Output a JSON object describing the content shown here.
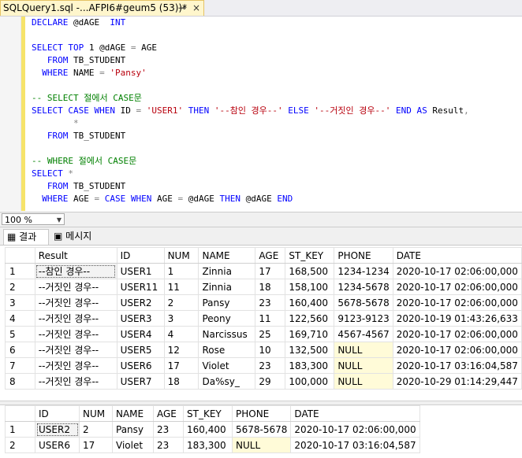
{
  "tab": {
    "title": "SQLQuery1.sql -...AFPI6#geum5 (53))*",
    "pin": "⊸",
    "close": "×"
  },
  "code_lines": [
    [
      [
        "kw",
        "DECLARE "
      ],
      [
        "t",
        "@dAGE  "
      ],
      [
        "kw",
        "INT"
      ]
    ],
    [],
    [
      [
        "kw",
        "SELECT TOP "
      ],
      [
        "t",
        "1 @dAGE "
      ],
      [
        "op",
        "= "
      ],
      [
        "t",
        "AGE"
      ]
    ],
    [
      [
        "t",
        "   "
      ],
      [
        "kw",
        "FROM "
      ],
      [
        "t",
        "TB_STUDENT"
      ]
    ],
    [
      [
        "t",
        "  "
      ],
      [
        "kw",
        "WHERE "
      ],
      [
        "t",
        "NAME "
      ],
      [
        "op",
        "= "
      ],
      [
        "str",
        "'Pansy'"
      ]
    ],
    [],
    [
      [
        "cm",
        "-- SELECT 절에서 CASE문"
      ]
    ],
    [
      [
        "kw",
        "SELECT CASE WHEN "
      ],
      [
        "t",
        "ID "
      ],
      [
        "op",
        "= "
      ],
      [
        "str",
        "'USER1' "
      ],
      [
        "kw",
        "THEN "
      ],
      [
        "str",
        "'--참인 경우--' "
      ],
      [
        "kw",
        "ELSE "
      ],
      [
        "str",
        "'--거짓인 경우--' "
      ],
      [
        "kw",
        "END AS "
      ],
      [
        "t",
        "Result"
      ],
      [
        "op",
        ","
      ]
    ],
    [
      [
        "t",
        "        "
      ],
      [
        "op",
        "*"
      ]
    ],
    [
      [
        "t",
        "   "
      ],
      [
        "kw",
        "FROM "
      ],
      [
        "t",
        "TB_STUDENT"
      ]
    ],
    [],
    [
      [
        "cm",
        "-- WHERE 절에서 CASE문"
      ]
    ],
    [
      [
        "kw",
        "SELECT "
      ],
      [
        "op",
        "*"
      ]
    ],
    [
      [
        "t",
        "   "
      ],
      [
        "kw",
        "FROM "
      ],
      [
        "t",
        "TB_STUDENT"
      ]
    ],
    [
      [
        "t",
        "  "
      ],
      [
        "kw",
        "WHERE "
      ],
      [
        "t",
        "AGE "
      ],
      [
        "op",
        "= "
      ],
      [
        "kw",
        "CASE WHEN "
      ],
      [
        "t",
        "AGE "
      ],
      [
        "op",
        "= "
      ],
      [
        "t",
        "@dAGE "
      ],
      [
        "kw",
        "THEN "
      ],
      [
        "t",
        "@dAGE "
      ],
      [
        "kw",
        "END"
      ]
    ]
  ],
  "zoom": {
    "value": "100 %",
    "arrow": "▼"
  },
  "result_tabs": [
    {
      "icon": "▦",
      "label": "결과"
    },
    {
      "icon": "▣",
      "label": "메시지"
    }
  ],
  "grid1": {
    "columns": [
      "Result",
      "ID",
      "NUM",
      "NAME",
      "AGE",
      "ST_KEY",
      "PHONE",
      "DATE"
    ],
    "rows": [
      [
        "1",
        "--참인 경우--",
        "USER1",
        "1",
        "Zinnia",
        "17",
        "168,500",
        "1234-1234",
        "2020-10-17 02:06:00,000"
      ],
      [
        "2",
        "--거짓인 경우--",
        "USER11",
        "11",
        "Zinnia",
        "18",
        "158,100",
        "1234-5678",
        "2020-10-17 02:06:00,000"
      ],
      [
        "3",
        "--거짓인 경우--",
        "USER2",
        "2",
        "Pansy",
        "23",
        "160,400",
        "5678-5678",
        "2020-10-17 02:06:00,000"
      ],
      [
        "4",
        "--거짓인 경우--",
        "USER3",
        "3",
        "Peony",
        "11",
        "122,560",
        "9123-9123",
        "2020-10-19 01:43:26,633"
      ],
      [
        "5",
        "--거짓인 경우--",
        "USER4",
        "4",
        "Narcissus",
        "25",
        "169,710",
        "4567-4567",
        "2020-10-17 02:06:00,000"
      ],
      [
        "6",
        "--거짓인 경우--",
        "USER5",
        "12",
        "Rose",
        "10",
        "132,500",
        "NULL",
        "2020-10-17 02:06:00,000"
      ],
      [
        "7",
        "--거짓인 경우--",
        "USER6",
        "17",
        "Violet",
        "23",
        "183,300",
        "NULL",
        "2020-10-17 03:16:04,587"
      ],
      [
        "8",
        "--거짓인 경우--",
        "USER7",
        "18",
        "Da%sy_",
        "29",
        "100,000",
        "NULL",
        "2020-10-29 01:14:29,447"
      ]
    ]
  },
  "grid2": {
    "columns": [
      "ID",
      "NUM",
      "NAME",
      "AGE",
      "ST_KEY",
      "PHONE",
      "DATE"
    ],
    "rows": [
      [
        "1",
        "USER2",
        "2",
        "Pansy",
        "23",
        "160,400",
        "5678-5678",
        "2020-10-17 02:06:00,000"
      ],
      [
        "2",
        "USER6",
        "17",
        "Violet",
        "23",
        "183,300",
        "NULL",
        "2020-10-17 03:16:04,587"
      ]
    ]
  }
}
